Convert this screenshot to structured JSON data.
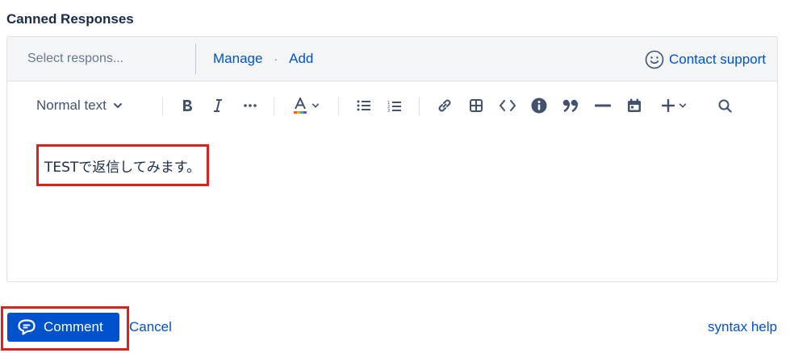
{
  "section": {
    "title": "Canned Responses"
  },
  "canned": {
    "select_placeholder": "Select respons...",
    "manage_label": "Manage",
    "separator": "·",
    "add_label": "Add",
    "contact_label": "Contact support"
  },
  "toolbar": {
    "text_style": "Normal text",
    "icons": [
      "bold-icon",
      "italic-icon",
      "more-formatting-icon",
      "text-color-icon",
      "bullet-list-icon",
      "numbered-list-icon",
      "link-icon",
      "table-icon",
      "code-icon",
      "info-icon",
      "quote-icon",
      "divider-icon",
      "date-icon",
      "insert-plus-icon",
      "search-icon"
    ]
  },
  "editor": {
    "content": "TESTで返信してみます。"
  },
  "footer": {
    "comment_label": "Comment",
    "cancel_label": "Cancel",
    "syntax_help_label": "syntax help"
  },
  "colors": {
    "accent": "#0052cc",
    "highlight_box": "#e01e1e",
    "text": "#172b4d",
    "icon": "#42526e"
  }
}
